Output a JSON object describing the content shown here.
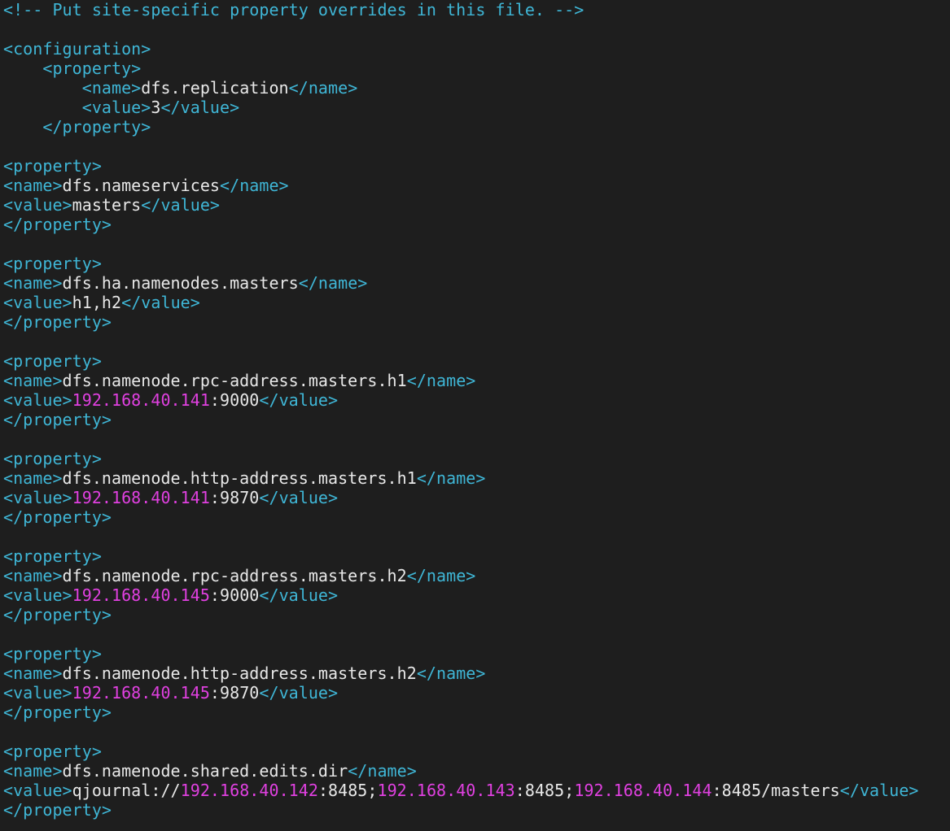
{
  "colors": {
    "background": "#1e1e1e",
    "tag": "#3fb6d6",
    "comment": "#3fb6d6",
    "text": "#e8e8e8",
    "ip": "#e040e0"
  },
  "lines": [
    [
      {
        "k": "comment",
        "t": "<!-- Put site-specific property overrides in this file. -->"
      }
    ],
    [],
    [
      {
        "k": "tag",
        "t": "<configuration>"
      }
    ],
    [
      {
        "k": "tag",
        "t": "    <property>"
      }
    ],
    [
      {
        "k": "tag",
        "t": "        <name>"
      },
      {
        "k": "text",
        "t": "dfs.replication"
      },
      {
        "k": "tag",
        "t": "</name>"
      }
    ],
    [
      {
        "k": "tag",
        "t": "        <value>"
      },
      {
        "k": "text",
        "t": "3"
      },
      {
        "k": "tag",
        "t": "</value>"
      }
    ],
    [
      {
        "k": "tag",
        "t": "    </property>"
      }
    ],
    [],
    [
      {
        "k": "tag",
        "t": "<property>"
      }
    ],
    [
      {
        "k": "tag",
        "t": "<name>"
      },
      {
        "k": "text",
        "t": "dfs.nameservices"
      },
      {
        "k": "tag",
        "t": "</name>"
      }
    ],
    [
      {
        "k": "tag",
        "t": "<value>"
      },
      {
        "k": "text",
        "t": "masters"
      },
      {
        "k": "tag",
        "t": "</value>"
      }
    ],
    [
      {
        "k": "tag",
        "t": "</property>"
      }
    ],
    [],
    [
      {
        "k": "tag",
        "t": "<property>"
      }
    ],
    [
      {
        "k": "tag",
        "t": "<name>"
      },
      {
        "k": "text",
        "t": "dfs.ha.namenodes.masters"
      },
      {
        "k": "tag",
        "t": "</name>"
      }
    ],
    [
      {
        "k": "tag",
        "t": "<value>"
      },
      {
        "k": "text",
        "t": "h1,h2"
      },
      {
        "k": "tag",
        "t": "</value>"
      }
    ],
    [
      {
        "k": "tag",
        "t": "</property>"
      }
    ],
    [],
    [
      {
        "k": "tag",
        "t": "<property>"
      }
    ],
    [
      {
        "k": "tag",
        "t": "<name>"
      },
      {
        "k": "text",
        "t": "dfs.namenode.rpc-address.masters.h1"
      },
      {
        "k": "tag",
        "t": "</name>"
      }
    ],
    [
      {
        "k": "tag",
        "t": "<value>"
      },
      {
        "k": "ip",
        "t": "192.168.40.141"
      },
      {
        "k": "text",
        "t": ":9000"
      },
      {
        "k": "tag",
        "t": "</value>"
      }
    ],
    [
      {
        "k": "tag",
        "t": "</property>"
      }
    ],
    [],
    [
      {
        "k": "tag",
        "t": "<property>"
      }
    ],
    [
      {
        "k": "tag",
        "t": "<name>"
      },
      {
        "k": "text",
        "t": "dfs.namenode.http-address.masters.h1"
      },
      {
        "k": "tag",
        "t": "</name>"
      }
    ],
    [
      {
        "k": "tag",
        "t": "<value>"
      },
      {
        "k": "ip",
        "t": "192.168.40.141"
      },
      {
        "k": "text",
        "t": ":9870"
      },
      {
        "k": "tag",
        "t": "</value>"
      }
    ],
    [
      {
        "k": "tag",
        "t": "</property>"
      }
    ],
    [],
    [
      {
        "k": "tag",
        "t": "<property>"
      }
    ],
    [
      {
        "k": "tag",
        "t": "<name>"
      },
      {
        "k": "text",
        "t": "dfs.namenode.rpc-address.masters.h2"
      },
      {
        "k": "tag",
        "t": "</name>"
      }
    ],
    [
      {
        "k": "tag",
        "t": "<value>"
      },
      {
        "k": "ip",
        "t": "192.168.40.145"
      },
      {
        "k": "text",
        "t": ":9000"
      },
      {
        "k": "tag",
        "t": "</value>"
      }
    ],
    [
      {
        "k": "tag",
        "t": "</property>"
      }
    ],
    [],
    [
      {
        "k": "tag",
        "t": "<property>"
      }
    ],
    [
      {
        "k": "tag",
        "t": "<name>"
      },
      {
        "k": "text",
        "t": "dfs.namenode.http-address.masters.h2"
      },
      {
        "k": "tag",
        "t": "</name>"
      }
    ],
    [
      {
        "k": "tag",
        "t": "<value>"
      },
      {
        "k": "ip",
        "t": "192.168.40.145"
      },
      {
        "k": "text",
        "t": ":9870"
      },
      {
        "k": "tag",
        "t": "</value>"
      }
    ],
    [
      {
        "k": "tag",
        "t": "</property>"
      }
    ],
    [],
    [
      {
        "k": "tag",
        "t": "<property>"
      }
    ],
    [
      {
        "k": "tag",
        "t": "<name>"
      },
      {
        "k": "text",
        "t": "dfs.namenode.shared.edits.dir"
      },
      {
        "k": "tag",
        "t": "</name>"
      }
    ],
    [
      {
        "k": "tag",
        "t": "<value>"
      },
      {
        "k": "text",
        "t": "qjournal://"
      },
      {
        "k": "ip",
        "t": "192.168.40.142"
      },
      {
        "k": "text",
        "t": ":8485;"
      },
      {
        "k": "ip",
        "t": "192.168.40.143"
      },
      {
        "k": "text",
        "t": ":8485;"
      },
      {
        "k": "ip",
        "t": "192.168.40.144"
      },
      {
        "k": "text",
        "t": ":8485/masters"
      },
      {
        "k": "tag",
        "t": "</value>"
      }
    ],
    [
      {
        "k": "tag",
        "t": "</property>"
      }
    ]
  ]
}
